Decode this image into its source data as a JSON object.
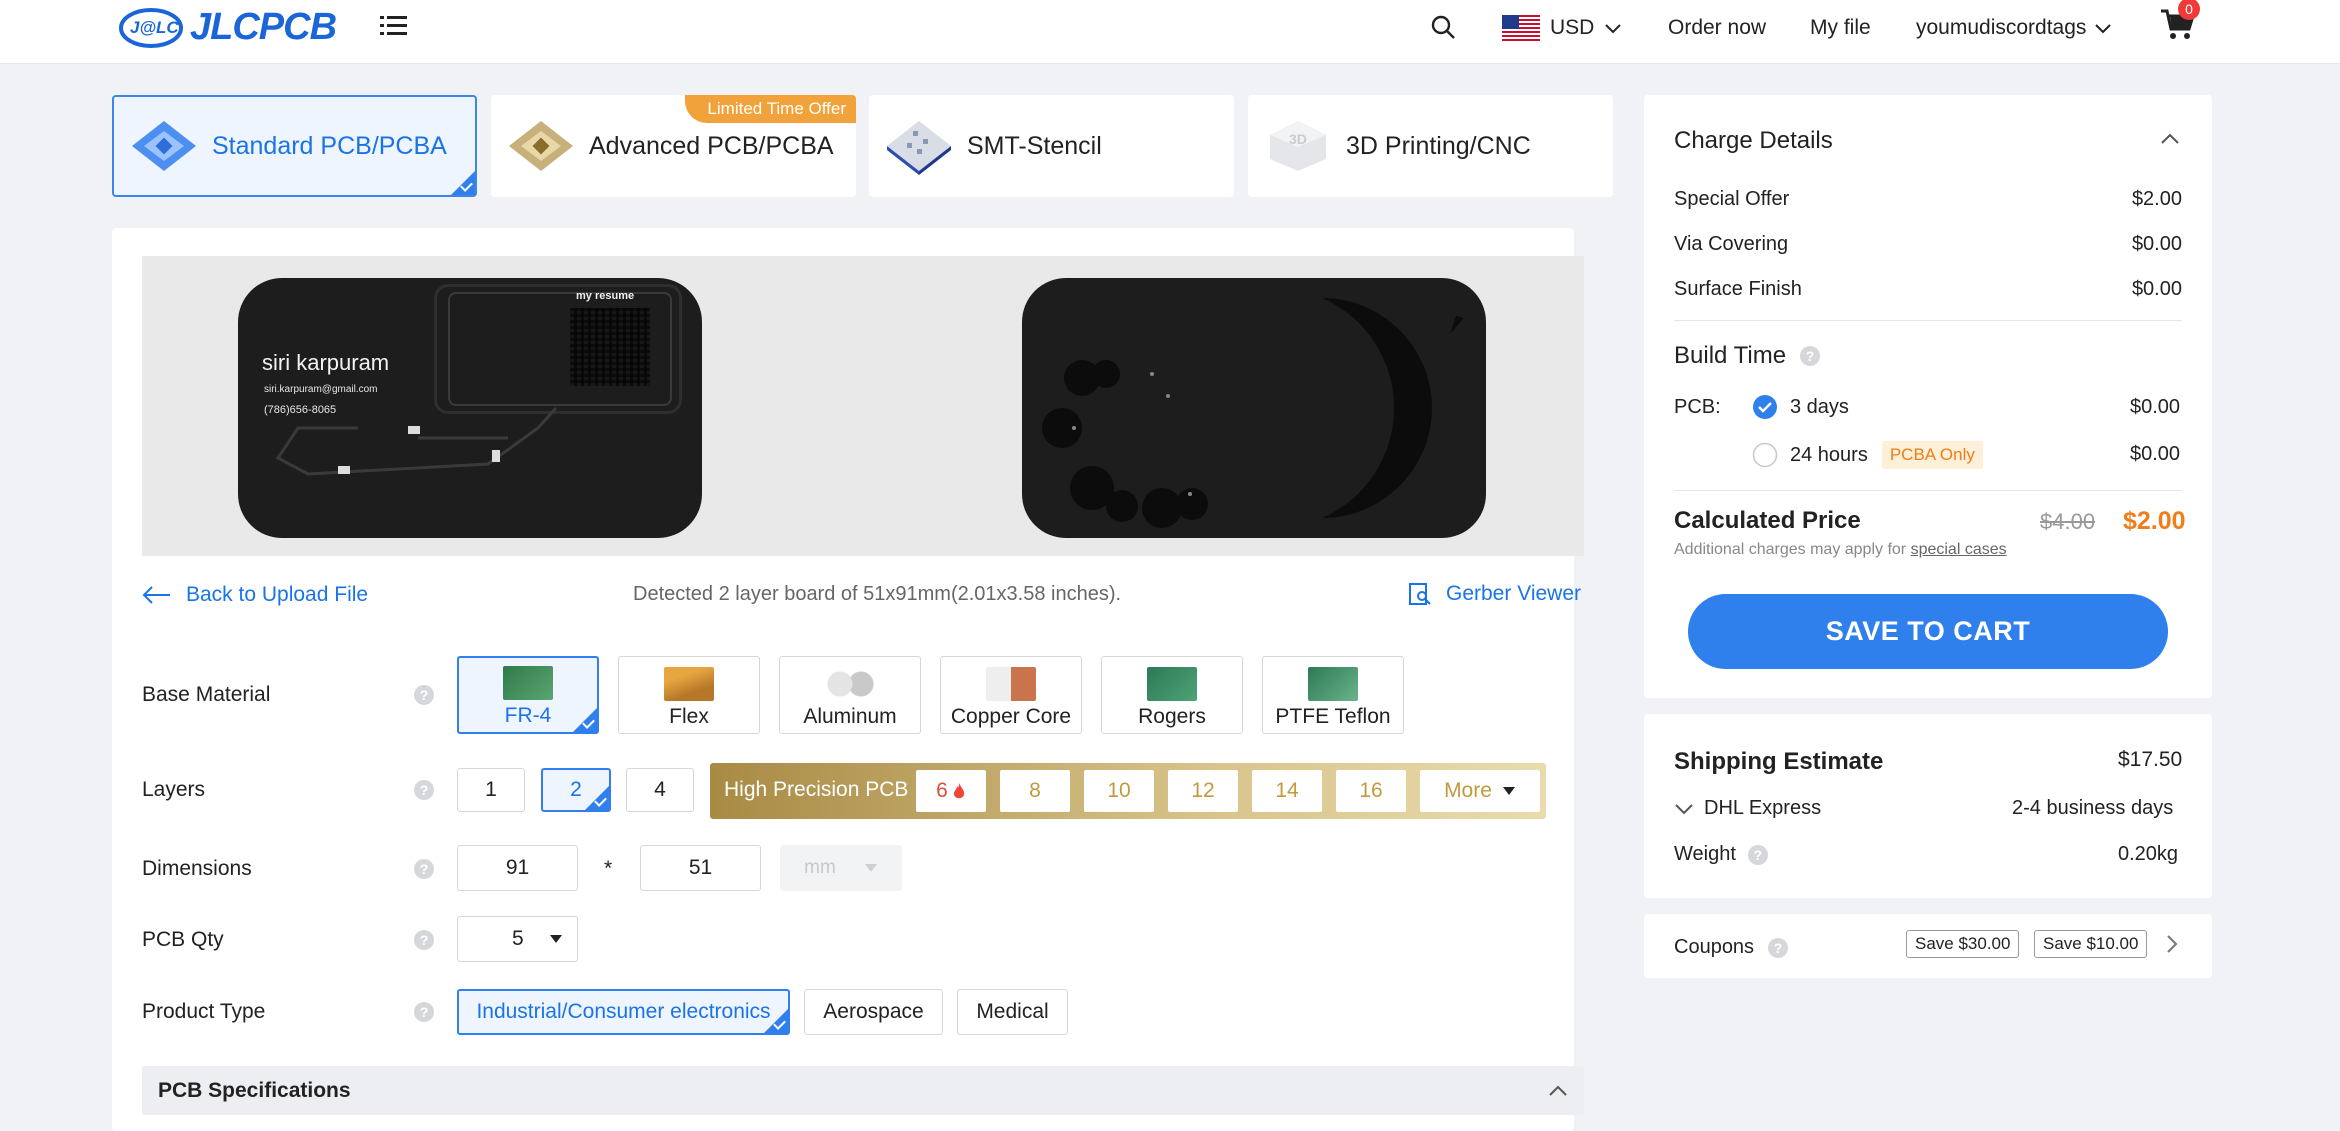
{
  "header": {
    "logo_badge": "J@LC",
    "logo_text": "JLCPCB",
    "currency": "USD",
    "order_now": "Order now",
    "my_file": "My file",
    "username": "youmudiscordtags",
    "cart_count": "0"
  },
  "tabs": [
    {
      "label": "Standard PCB/PCBA"
    },
    {
      "label": "Advanced PCB/PCBA",
      "badge": "Limited Time Offer"
    },
    {
      "label": "SMT-Stencil"
    },
    {
      "label": "3D Printing/CNC"
    }
  ],
  "preview": {
    "name": "siri karpuram",
    "email": "siri.karpuram@gmail.com",
    "phone": "(786)656-8065",
    "qr_label": "my resume"
  },
  "upload": {
    "back": "Back to Upload File",
    "detected": "Detected 2 layer board of 51x91mm(2.01x3.58 inches).",
    "gerber": "Gerber Viewer"
  },
  "base_material": {
    "label": "Base Material",
    "options": [
      "FR-4",
      "Flex",
      "Aluminum",
      "Copper Core",
      "Rogers",
      "PTFE Teflon"
    ],
    "selected": "FR-4"
  },
  "layers": {
    "label": "Layers",
    "options": [
      "1",
      "2",
      "4"
    ],
    "selected": "2",
    "hp_label": "High Precision PCB",
    "hp_options": [
      "6",
      "8",
      "10",
      "12",
      "14",
      "16"
    ],
    "more": "More"
  },
  "dimensions": {
    "label": "Dimensions",
    "length": "91",
    "width": "51",
    "sep": "*",
    "unit": "mm"
  },
  "qty": {
    "label": "PCB Qty",
    "value": "5"
  },
  "product_type": {
    "label": "Product Type",
    "options": [
      "Industrial/Consumer electronics",
      "Aerospace",
      "Medical"
    ],
    "selected": "Industrial/Consumer electronics"
  },
  "specs_title": "PCB Specifications",
  "charge": {
    "title": "Charge Details",
    "items": [
      {
        "label": "Special Offer",
        "value": "$2.00"
      },
      {
        "label": "Via Covering",
        "value": "$0.00"
      },
      {
        "label": "Surface Finish",
        "value": "$0.00"
      }
    ],
    "build_time": "Build Time",
    "pcb_label": "PCB:",
    "options": [
      {
        "label": "3 days",
        "value": "$0.00",
        "checked": true
      },
      {
        "label": "24 hours",
        "value": "$0.00",
        "tag": "PCBA Only"
      }
    ],
    "calc_label": "Calculated Price",
    "old_price": "$4.00",
    "price": "$2.00",
    "note": "Additional charges may apply for ",
    "note_link": "special cases",
    "cart_button": "SAVE TO CART"
  },
  "shipping": {
    "title": "Shipping Estimate",
    "price": "$17.50",
    "carrier": "DHL Express",
    "days": "2-4 business days",
    "weight_label": "Weight",
    "weight": "0.20kg"
  },
  "coupons": {
    "label": "Coupons",
    "items": [
      "Save $30.00",
      "Save $10.00"
    ]
  },
  "colors": {
    "accent": "#2f80ed",
    "price": "#f07d1a",
    "gold": "#c29a3b"
  }
}
